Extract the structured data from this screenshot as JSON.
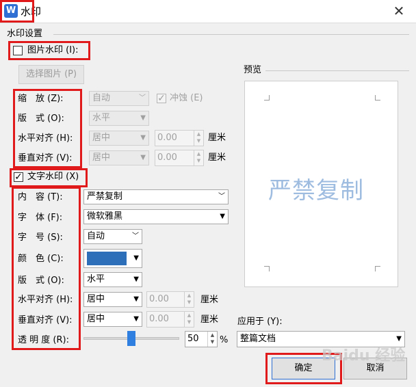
{
  "title": {
    "app_icon": "W",
    "text": "水印",
    "close": "✕"
  },
  "group": {
    "label": "水印设置"
  },
  "picture": {
    "checkbox_label": "图片水印 (I):",
    "checked": false,
    "select_button": "选择图片 (P)",
    "scale_label": "缩　放 (Z):",
    "scale_value": "自动",
    "washout_label": "冲蚀 (E)",
    "washout_checked": true,
    "layout_label": "版　式 (O):",
    "layout_value": "水平",
    "halign_label": "水平对齐 (H):",
    "halign_value": "居中",
    "halign_offset": "0.00",
    "halign_unit": "厘米",
    "valign_label": "垂直对齐 (V):",
    "valign_value": "居中",
    "valign_offset": "0.00",
    "valign_unit": "厘米"
  },
  "text": {
    "checkbox_label": "文字水印 (X)",
    "checked": true,
    "content_label": "内　容 (T):",
    "content_value": "严禁复制",
    "font_label": "字　体 (F):",
    "font_value": "微软雅黑",
    "size_label": "字　号 (S):",
    "size_value": "自动",
    "color_label": "颜　色 (C):",
    "color_value": "#2d6fb8",
    "layout_label": "版　式 (O):",
    "layout_value": "水平",
    "halign_label": "水平对齐 (H):",
    "halign_value": "居中",
    "halign_offset": "0.00",
    "halign_unit": "厘米",
    "valign_label": "垂直对齐 (V):",
    "valign_value": "居中",
    "valign_offset": "0.00",
    "valign_unit": "厘米",
    "transparency_label": "透 明 度 (R):",
    "transparency_value": "50",
    "transparency_unit": "%"
  },
  "preview": {
    "label": "预览",
    "watermark_text": "严禁复制"
  },
  "apply": {
    "label": "应用于 (Y):",
    "value": "整篇文档"
  },
  "buttons": {
    "ok": "确定",
    "cancel": "取消"
  },
  "overlay": {
    "watermark_brand": "Baidu 经验"
  }
}
